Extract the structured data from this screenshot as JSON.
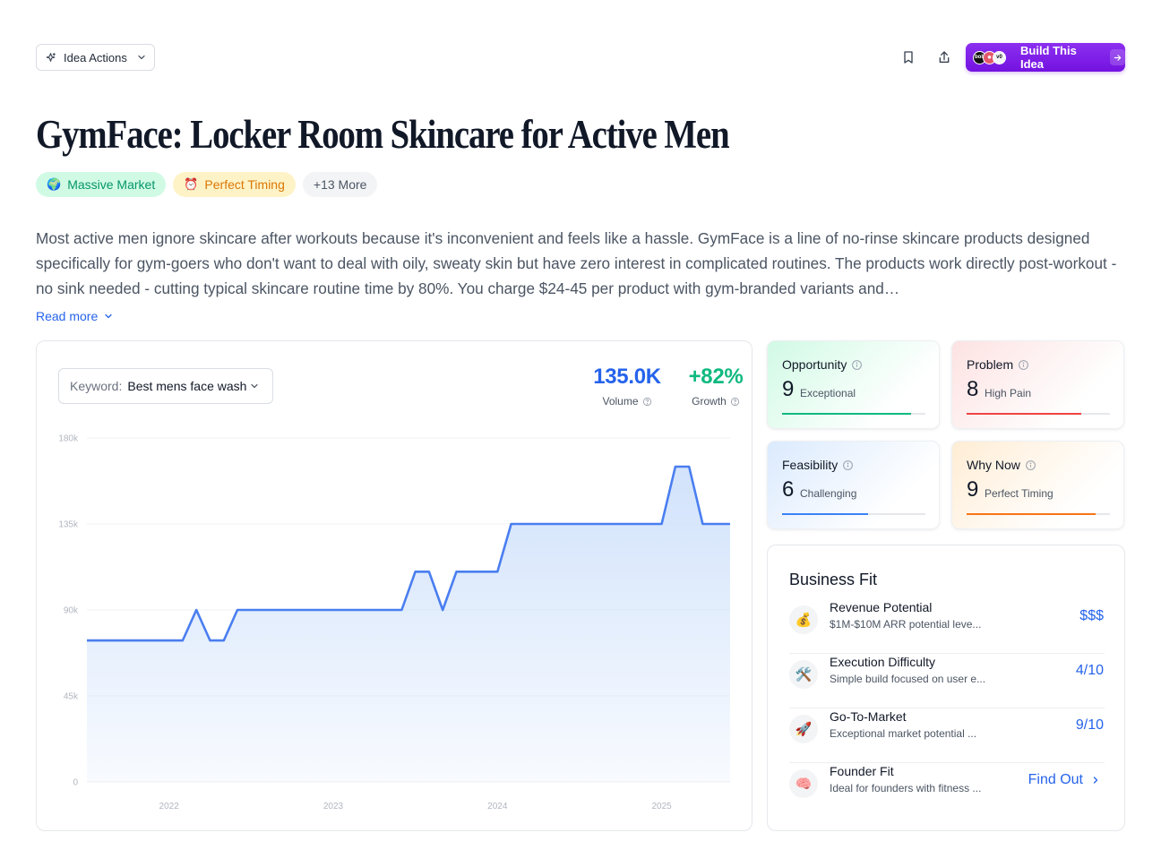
{
  "header": {
    "idea_actions_label": "Idea Actions",
    "build_button_label": "Build This Idea",
    "build_avatars": [
      "bolt",
      "claude",
      "v0"
    ]
  },
  "title": "GymFace: Locker Room Skincare for Active Men",
  "tags": [
    {
      "icon": "🌍",
      "label": "Massive Market",
      "color": "#059669"
    },
    {
      "icon": "⏰",
      "label": "Perfect Timing",
      "color": "#d97706"
    },
    {
      "label": "+13 More"
    }
  ],
  "description": "Most active men ignore skincare after workouts because it's inconvenient and feels like a hassle. GymFace is a line of no-rinse skincare products designed specifically for gym-goers who don't want to deal with oily, sweaty skin but have zero interest in complicated routines. The products work directly post-workout - no sink needed - cutting typical skincare routine time by 80%. You charge $24-45 per product with gym-branded variants and…",
  "read_more_label": "Read more",
  "keyword": {
    "label": "Keyword:",
    "value": "Best mens face wash"
  },
  "metrics": {
    "volume": {
      "value": "135.0K",
      "label": "Volume"
    },
    "growth": {
      "value": "+82%",
      "label": "Growth"
    }
  },
  "chart_data": {
    "type": "area",
    "x": [
      "2021-07",
      "2021-08",
      "2021-09",
      "2021-10",
      "2021-11",
      "2021-12",
      "2022-01",
      "2022-02",
      "2022-03",
      "2022-04",
      "2022-05",
      "2022-06",
      "2022-07",
      "2022-08",
      "2022-09",
      "2022-10",
      "2022-11",
      "2022-12",
      "2023-01",
      "2023-02",
      "2023-03",
      "2023-04",
      "2023-05",
      "2023-06",
      "2023-07",
      "2023-08",
      "2023-09",
      "2023-10",
      "2023-11",
      "2023-12",
      "2024-01",
      "2024-02",
      "2024-03",
      "2024-04",
      "2024-05",
      "2024-06",
      "2024-07",
      "2024-08",
      "2024-09",
      "2024-10",
      "2024-11",
      "2024-12",
      "2025-01",
      "2025-02",
      "2025-03",
      "2025-04",
      "2025-05",
      "2025-06"
    ],
    "values": [
      74000,
      74000,
      74000,
      74000,
      74000,
      74000,
      74000,
      74000,
      90000,
      74000,
      74000,
      90000,
      90000,
      90000,
      90000,
      90000,
      90000,
      90000,
      90000,
      90000,
      90000,
      90000,
      90000,
      90000,
      110000,
      110000,
      90000,
      110000,
      110000,
      110000,
      110000,
      135000,
      135000,
      135000,
      135000,
      135000,
      135000,
      135000,
      135000,
      135000,
      135000,
      135000,
      135000,
      165000,
      165000,
      135000,
      135000,
      135000
    ],
    "xtick_labels": [
      "2022",
      "2023",
      "2024",
      "2025"
    ],
    "ytick_labels": [
      "0",
      "45k",
      "90k",
      "135k",
      "180k"
    ],
    "ylim": [
      0,
      180000
    ],
    "grid": true,
    "line_color": "#4a7ef0",
    "fill_color": "#cfe1fb"
  },
  "scores": [
    {
      "label": "Opportunity",
      "value": "9",
      "desc": "Exceptional",
      "pct": 0.9,
      "color": "#10b981"
    },
    {
      "label": "Problem",
      "value": "8",
      "desc": "High Pain",
      "pct": 0.8,
      "color": "#ef4444"
    },
    {
      "label": "Feasibility",
      "value": "6",
      "desc": "Challenging",
      "pct": 0.6,
      "color": "#3b82f6"
    },
    {
      "label": "Why Now",
      "value": "9",
      "desc": "Perfect Timing",
      "pct": 0.9,
      "color": "#f97316"
    }
  ],
  "business_fit": {
    "title": "Business Fit",
    "rows": [
      {
        "icon": "💰",
        "name": "Revenue Potential",
        "sub": "$1M-$10M ARR potential leve...",
        "value": "$$$"
      },
      {
        "icon": "🛠️",
        "name": "Execution Difficulty",
        "sub": "Simple build focused on user e...",
        "value": "4/10"
      },
      {
        "icon": "🚀",
        "name": "Go-To-Market",
        "sub": "Exceptional market potential ...",
        "value": "9/10"
      },
      {
        "icon": "🧠",
        "name": "Founder Fit",
        "sub": "Ideal for founders with fitness ...",
        "value": "Find Out"
      }
    ]
  }
}
